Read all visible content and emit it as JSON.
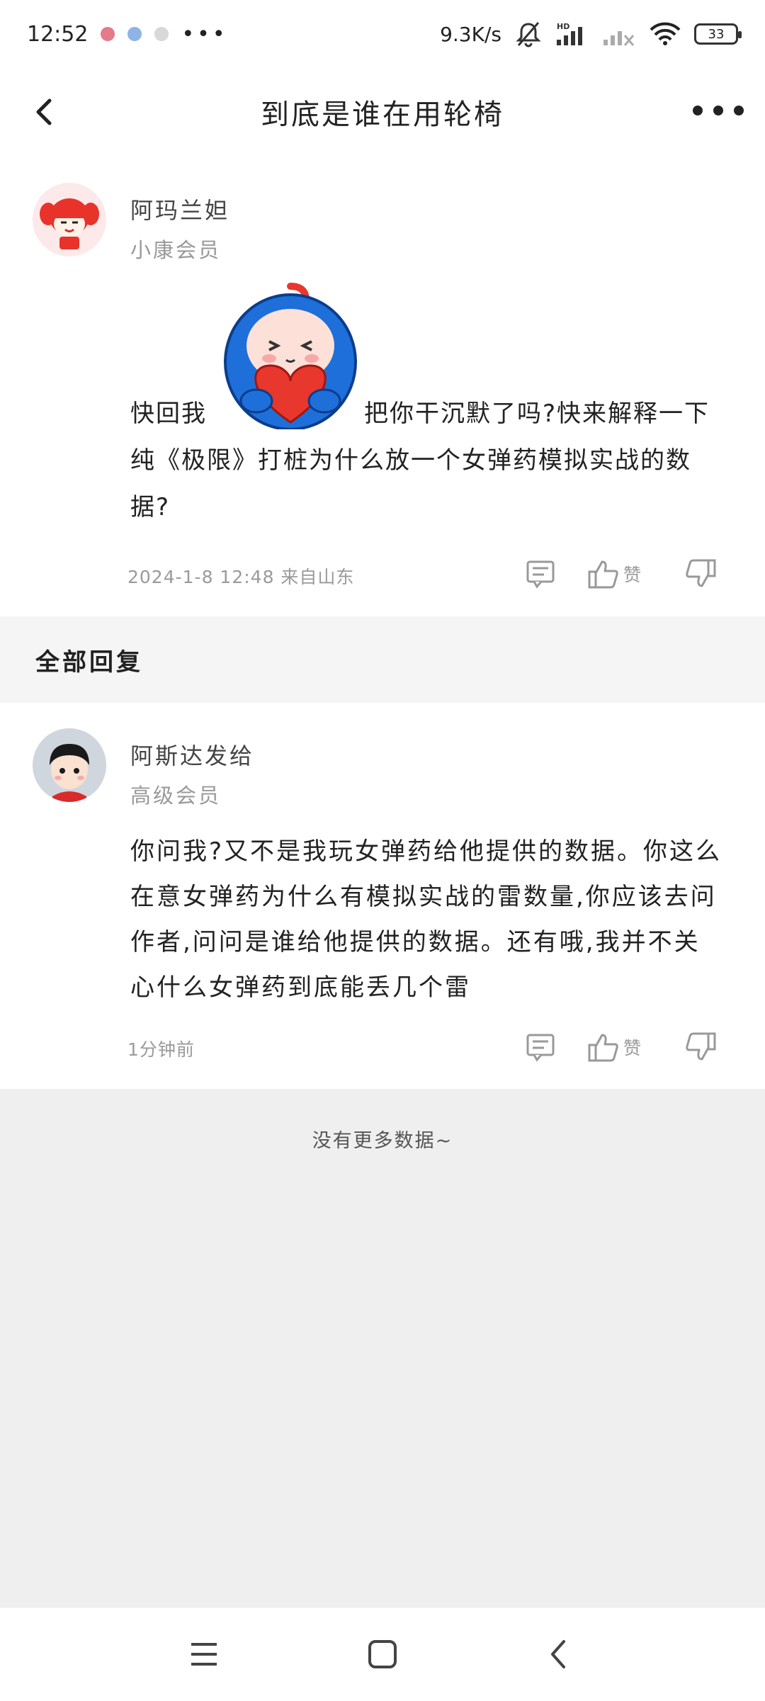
{
  "status_bar": {
    "time": "12:52",
    "more": "•••",
    "net_speed": "9.3K/s",
    "battery": "33"
  },
  "header": {
    "title": "到底是谁在用轮椅"
  },
  "post": {
    "user": {
      "name": "阿玛兰妲",
      "level": "小康会员"
    },
    "text_before_sticker": "快回我",
    "text_after_sticker": "把你干沉默了吗?快来解释一下纯《极限》打桩为什么放一个女弹药模拟实战的数据?",
    "meta": "2024-1-8 12:48  来自山东",
    "like_label": "赞"
  },
  "section": {
    "title": "全部回复"
  },
  "reply": {
    "user": {
      "name": "阿斯达发给",
      "level": "高级会员"
    },
    "text": "你问我?又不是我玩女弹药给他提供的数据。你这么在意女弹药为什么有模拟实战的雷数量,你应该去问作者,问问是谁给他提供的数据。还有哦,我并不关心什么女弹药到底能丢几个雷",
    "time": "1分钟前",
    "like_label": "赞"
  },
  "footer": {
    "end_message": "没有更多数据~"
  },
  "colors": {
    "accent_blue": "#1e6fd9",
    "heart_red": "#e8372c",
    "avatar_red": "#e8332a"
  }
}
